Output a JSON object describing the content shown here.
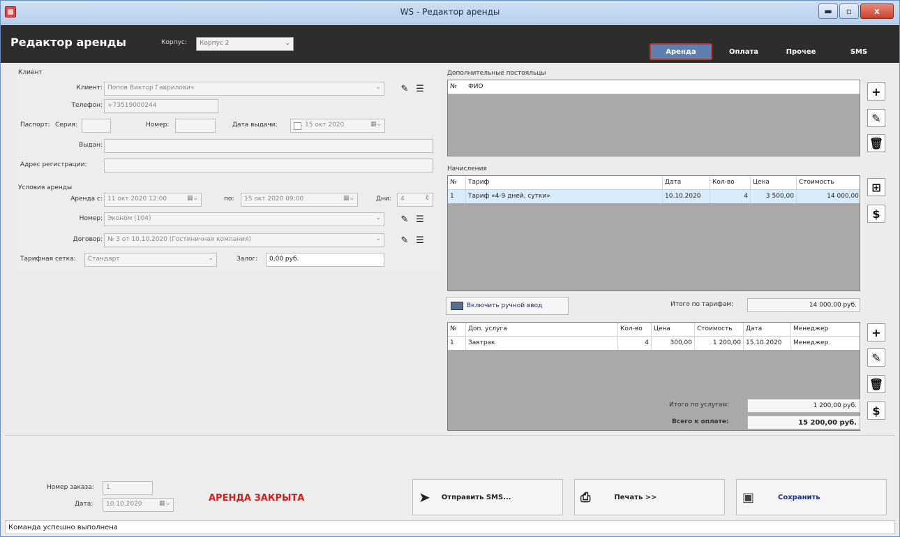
{
  "window": {
    "title": "WS - Редактор аренды",
    "min": "▬",
    "max": "▫",
    "close": "x"
  },
  "header": {
    "app_title": "Редактор аренды",
    "korpus_label": "Корпус:",
    "korpus_value": "Корпус 2",
    "tabs": [
      {
        "label": "Аренда"
      },
      {
        "label": "Оплата"
      },
      {
        "label": "Прочее"
      },
      {
        "label": "SMS"
      }
    ],
    "active_tab": "Аренда"
  },
  "client": {
    "section": "Клиент",
    "client_label": "Клиент:",
    "client_value": "Попов Виктор Гаврилович",
    "phone_label": "Телефон:",
    "phone_value": "+73519000244",
    "passport_label": "Паспорт:",
    "series_label": "Серия:",
    "series_value": "",
    "number_label": "Номер:",
    "number_value": "",
    "issue_date_label": "Дата выдачи:",
    "issue_date_value": "15 окт 2020",
    "issued_by_label": "Выдан:",
    "issued_by_value": "",
    "address_label": "Адрес регистрации:",
    "address_value": ""
  },
  "rent": {
    "section": "Условия аренды",
    "from_label": "Аренда с:",
    "from_value": "11 окт 2020 12:00",
    "to_label": "по:",
    "to_value": "15 окт 2020 09:00",
    "days_label": "Дни:",
    "days_value": "4",
    "room_label": "Номер:",
    "room_value": "Эконом (104)",
    "contract_label": "Договор:",
    "contract_value": "№ 3 от 10.10.2020 (Гостиничная компания)",
    "tariff_grid_label": "Тарифная сетка:",
    "tariff_grid_value": "Стандарт",
    "deposit_label": "Залог:",
    "deposit_value": "0,00 руб."
  },
  "guests": {
    "section": "Дополнительные постояльцы",
    "columns": [
      "№",
      "ФИО"
    ],
    "rows": []
  },
  "charges": {
    "section": "Начисления",
    "columns": [
      "№",
      "Тариф",
      "Дата",
      "Кол-во",
      "Цена",
      "Стоимость"
    ],
    "rows": [
      [
        "1",
        "Тариф «4-9 дней, сутки»",
        "10.10.2020",
        "4",
        "3 500,00",
        "14 000,00"
      ]
    ],
    "manual_btn": "Включить ручной ввод",
    "total_label": "Итого по тарифам:",
    "total_value": "14 000,00 руб."
  },
  "services": {
    "columns": [
      "№",
      "Доп. услуга",
      "Кол-во",
      "Цена",
      "Стоимость",
      "Дата",
      "Менеджер"
    ],
    "rows": [
      [
        "1",
        "Завтрак",
        "4",
        "300,00",
        "1 200,00",
        "15.10.2020",
        "Менеджер"
      ]
    ],
    "total_label": "Итого по услугам:",
    "total_value": "1 200,00 руб.",
    "grand_label": "Всего к оплате:",
    "grand_value": "15 200,00 руб."
  },
  "footer": {
    "order_label": "Номер заказа:",
    "order_value": "1",
    "date_label": "Дата:",
    "date_value": "10.10.2020",
    "status": "АРЕНДА ЗАКРЫТА",
    "sms_btn": "Отправить SMS...",
    "print_btn": "Печать  >>",
    "save_btn": "Сохранить",
    "statusbar": "Команда успешно выполнена"
  },
  "colors": {
    "status_red": "#d42020",
    "tab_active": "#5f7fb0",
    "header_bg": "#2d2d2d",
    "save_blue": "#1b2e8c"
  },
  "icons": [
    "pencil-icon",
    "list-icon",
    "plus-icon",
    "trash-icon",
    "dollar-icon",
    "calc-icon",
    "send-icon",
    "printer-icon",
    "floppy-icon",
    "calendar-icon",
    "keyboard-icon"
  ]
}
